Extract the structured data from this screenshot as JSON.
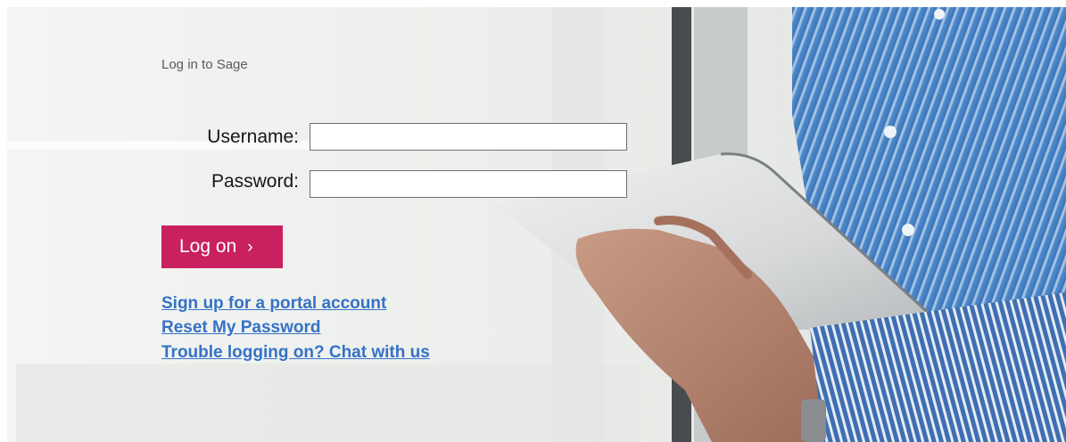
{
  "login": {
    "title": "Log in to Sage",
    "username_label": "Username:",
    "username_value": "",
    "password_label": "Password:",
    "password_value": "",
    "logon_label": "Log on",
    "logon_chevron": "›"
  },
  "links": {
    "signup": "Sign up for a portal account",
    "reset": "Reset My Password",
    "trouble": "Trouble logging on? Chat with us"
  },
  "colors": {
    "button_bg": "#c9205f",
    "link": "#3572c7",
    "shirt_blue": "#4a86c8"
  }
}
